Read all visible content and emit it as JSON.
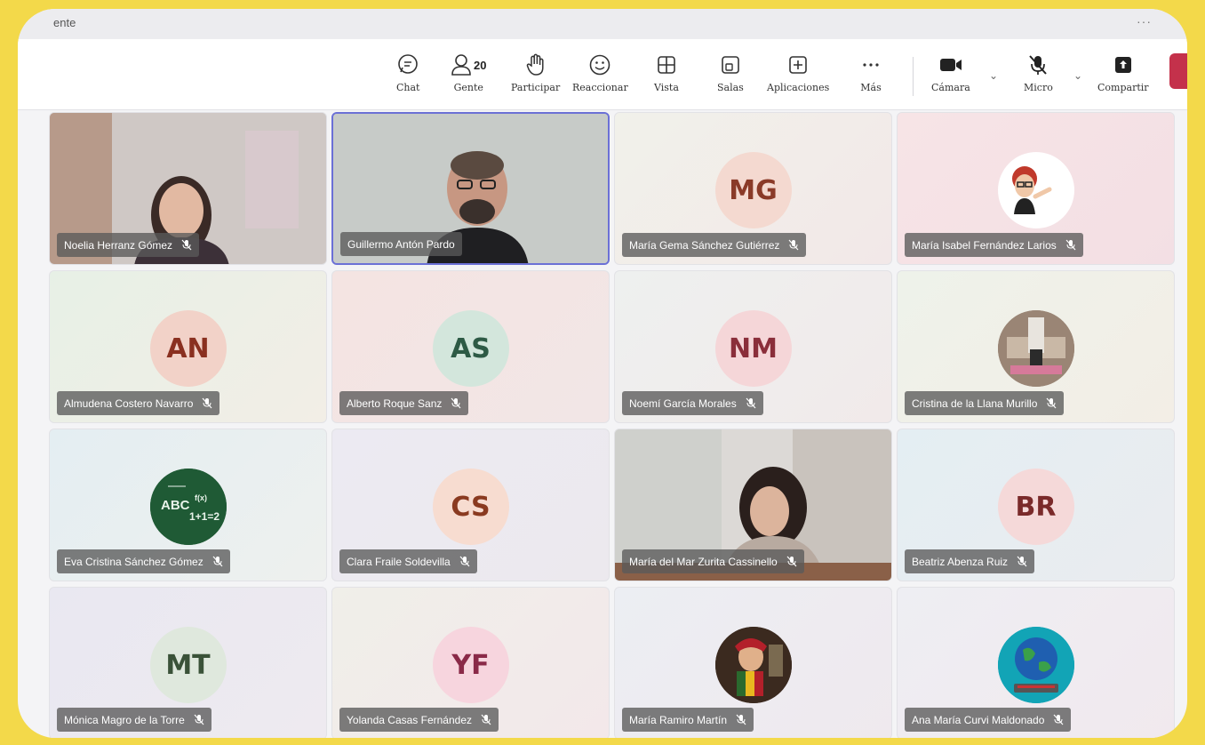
{
  "window": {
    "title": "ente",
    "menu": "···"
  },
  "toolbar": {
    "chat": "Chat",
    "people": "Gente",
    "people_count": "20",
    "raise": "Participar",
    "react": "Reaccionar",
    "view": "Vista",
    "rooms": "Salas",
    "apps": "Aplicaciones",
    "more": "Más",
    "camera": "Cámara",
    "mic": "Micro",
    "share": "Compartir"
  },
  "participants": [
    {
      "name": "Noelia Herranz Gómez",
      "type": "video"
    },
    {
      "name": "Guillermo Antón Pardo",
      "type": "video",
      "active": true
    },
    {
      "name": "María Gema Sánchez Gutiérrez",
      "initials": "MG",
      "bg": "#f4d9d0",
      "fg": "#8a3a28"
    },
    {
      "name": "María Isabel Fernández Larios",
      "type": "photo",
      "icon": "bitmoji-avatar"
    },
    {
      "name": "Almudena Costero Navarro",
      "initials": "AN",
      "bg": "#f2d2c8",
      "fg": "#8a3020"
    },
    {
      "name": "Alberto Roque Sanz",
      "initials": "AS",
      "bg": "#d3e6dc",
      "fg": "#2d5a45"
    },
    {
      "name": "Noemí García Morales",
      "initials": "NM",
      "bg": "#f5d6d8",
      "fg": "#8a2e3a"
    },
    {
      "name": "Cristina de la Llana Murillo",
      "type": "photo",
      "icon": "room-photo-avatar"
    },
    {
      "name": "Eva Cristina Sánchez Gómez",
      "type": "photo",
      "icon": "chalkboard-avatar"
    },
    {
      "name": "Clara Fraile Soldevilla",
      "initials": "CS",
      "bg": "#f7dcd0",
      "fg": "#8a3a20"
    },
    {
      "name": "María del Mar Zurita Cassinello",
      "type": "video"
    },
    {
      "name": "Beatriz Abenza Ruiz",
      "initials": "BR",
      "bg": "#f5d9d9",
      "fg": "#7a2a2a"
    },
    {
      "name": "Mónica Magro de la Torre",
      "initials": "MT",
      "bg": "#dfe8dd",
      "fg": "#3a5238"
    },
    {
      "name": "Yolanda Casas Fernández",
      "initials": "YF",
      "bg": "#f7d5de",
      "fg": "#8a2a48"
    },
    {
      "name": "María Ramiro Martín",
      "type": "photo",
      "icon": "painting-avatar"
    },
    {
      "name": "Ana María Curvi Maldonado",
      "type": "photo",
      "icon": "globe-avatar"
    }
  ],
  "colors": {
    "accent_border": "#6b70d6",
    "hangup": "#c4314b",
    "frame": "#f3d94a"
  }
}
